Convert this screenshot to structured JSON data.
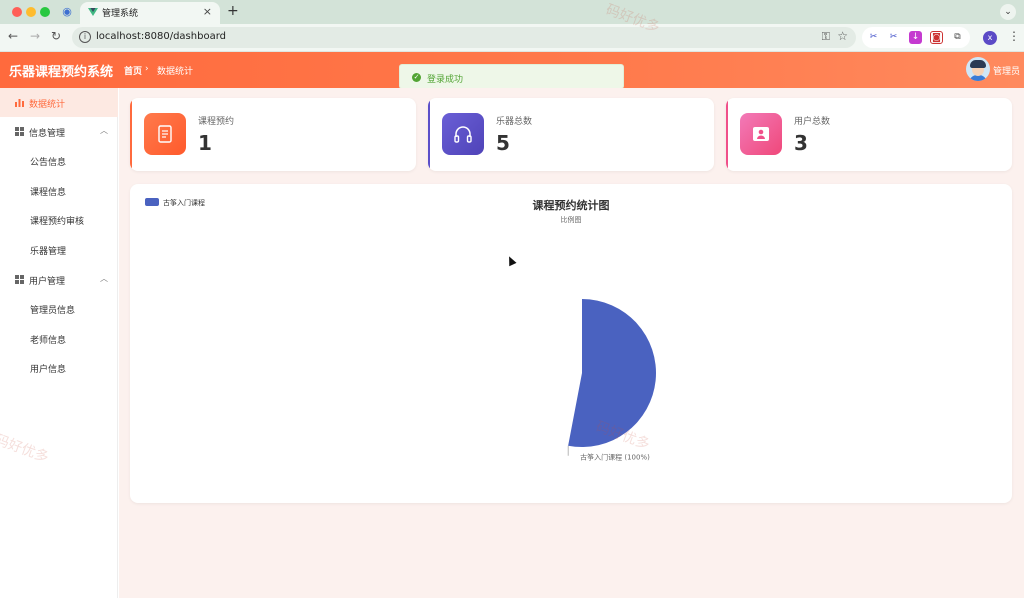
{
  "browser": {
    "tab_title": "管理系统",
    "url": "localhost:8080/dashboard",
    "profile_initial": "x",
    "new_tab": "+",
    "tab_close": "×"
  },
  "header": {
    "brand": "乐器课程预约系统",
    "breadcrumb": [
      "首页",
      "数据统计"
    ],
    "breadcrumb_sep": "›",
    "user_name": "管理员"
  },
  "toast": {
    "text": "登录成功",
    "color": "#52a434"
  },
  "sidebar": {
    "items": [
      {
        "label": "数据统计",
        "active": true
      },
      {
        "label": "信息管理",
        "expanded": true,
        "children": [
          "公告信息",
          "课程信息",
          "课程预约审核",
          "乐器管理"
        ]
      },
      {
        "label": "用户管理",
        "expanded": true,
        "children": [
          "管理员信息",
          "老师信息",
          "用户信息"
        ]
      }
    ],
    "accent": "#ff6a3d"
  },
  "stats": [
    {
      "label": "课程预约",
      "value": "1",
      "color": "#ff6a3d",
      "icon": "document-icon"
    },
    {
      "label": "乐器总数",
      "value": "5",
      "color": "#5b4fc9",
      "icon": "headphones-icon"
    },
    {
      "label": "用户总数",
      "value": "3",
      "color": "#f0508a",
      "icon": "user-icon"
    }
  ],
  "chart_data": {
    "type": "pie",
    "title": "课程预约统计图",
    "subtitle": "比例图",
    "legend": [
      "古筝入门课程"
    ],
    "legend_position": "top-left",
    "slices": [
      {
        "name": "古筝入门课程",
        "value": 1,
        "percent": 100,
        "label": "古筝入门课程 (100%)",
        "color": "#4a62c0"
      }
    ]
  },
  "watermark": "码好优多"
}
